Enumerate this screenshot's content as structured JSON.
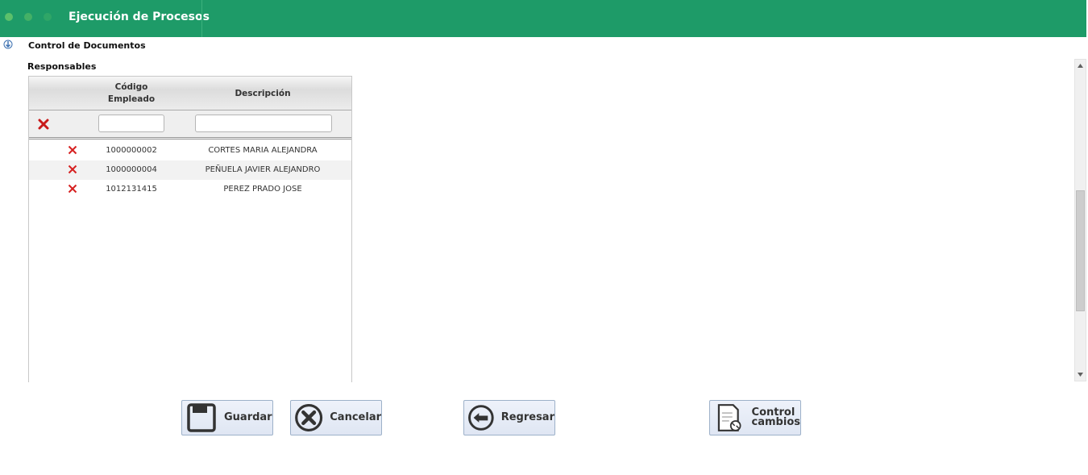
{
  "header": {
    "title": "Ejecución de Procesos"
  },
  "section": {
    "title": "Control de Documentos",
    "subtitle": "Responsables"
  },
  "grid": {
    "columns": {
      "code": "Código\nEmpleado",
      "code_line1": "Código",
      "code_line2": "Empleado",
      "description": "Descripción"
    },
    "filters": {
      "code_value": "",
      "description_value": ""
    },
    "rows": [
      {
        "code": "1000000002",
        "description": "CORTES MARIA ALEJANDRA"
      },
      {
        "code": "1000000004",
        "description": "PEÑUELA JAVIER ALEJANDRO"
      },
      {
        "code": "1012131415",
        "description": "PEREZ PRADO JOSE"
      }
    ]
  },
  "buttons": {
    "save": "Guardar",
    "cancel": "Cancelar",
    "back": "Regresar",
    "control_line1": "Control",
    "control_line2": "cambios"
  },
  "colors": {
    "header_bg": "#1e9b68",
    "delete_red": "#d62020"
  }
}
